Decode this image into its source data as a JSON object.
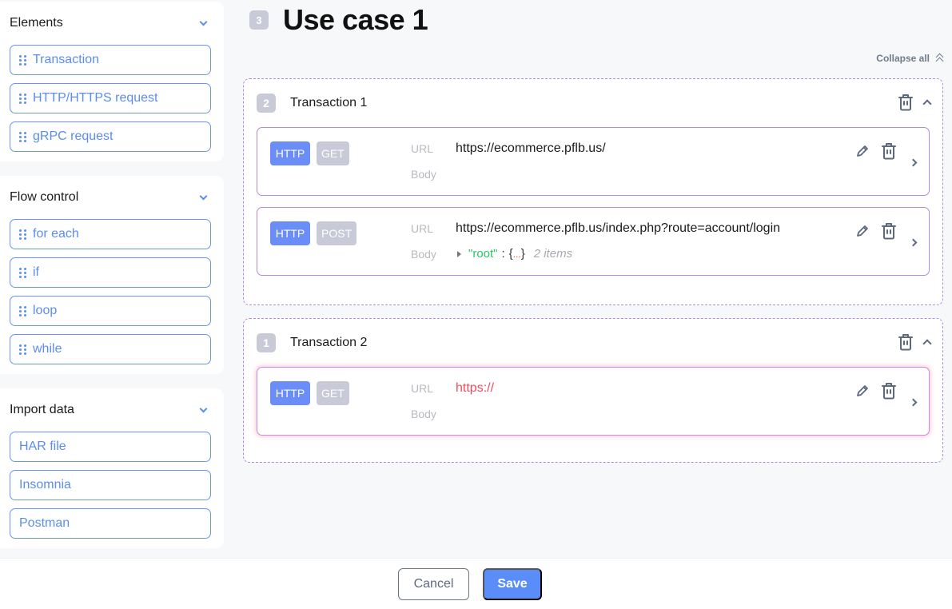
{
  "sidebar": {
    "sections": [
      {
        "title": "Elements",
        "items": [
          {
            "label": "Transaction"
          },
          {
            "label": "HTTP/HTTPS request"
          },
          {
            "label": "gRPC request"
          }
        ]
      },
      {
        "title": "Flow control",
        "items": [
          {
            "label": "for each"
          },
          {
            "label": "if"
          },
          {
            "label": "loop"
          },
          {
            "label": "while"
          }
        ]
      },
      {
        "title": "Import data",
        "items": [
          {
            "label": "HAR file"
          },
          {
            "label": "Insomnia"
          },
          {
            "label": "Postman"
          }
        ]
      }
    ]
  },
  "usecase": {
    "badge": "3",
    "title": "Use case 1",
    "collapse_all_label": "Collapse all"
  },
  "transactions": [
    {
      "badge": "2",
      "title": "Transaction 1",
      "requests": [
        {
          "protocol": "HTTP",
          "method": "GET",
          "url_label": "URL",
          "body_label": "Body",
          "url": "https://ecommerce.pflb.us/"
        },
        {
          "protocol": "HTTP",
          "method": "POST",
          "url_label": "URL",
          "body_label": "Body",
          "url": "https://ecommerce.pflb.us/index.php?route=account/login",
          "body": {
            "key": "\"root\"",
            "colon": ":",
            "open": "{",
            "ellipsis": "...",
            "close": "}",
            "count": "2 items"
          }
        }
      ]
    },
    {
      "badge": "1",
      "title": "Transaction 2",
      "requests": [
        {
          "protocol": "HTTP",
          "method": "GET",
          "url_label": "URL",
          "body_label": "Body",
          "url": "https://"
        }
      ]
    }
  ],
  "footer": {
    "cancel_label": "Cancel",
    "save_label": "Save"
  },
  "colors": {
    "accent": "#5b8df8",
    "tag_protocol": "#6b8df7",
    "tag_method": "#c9cad8",
    "dashed_border": "#b089e6",
    "error_url": "#ef4d5b",
    "json_key": "#2bc46a"
  }
}
